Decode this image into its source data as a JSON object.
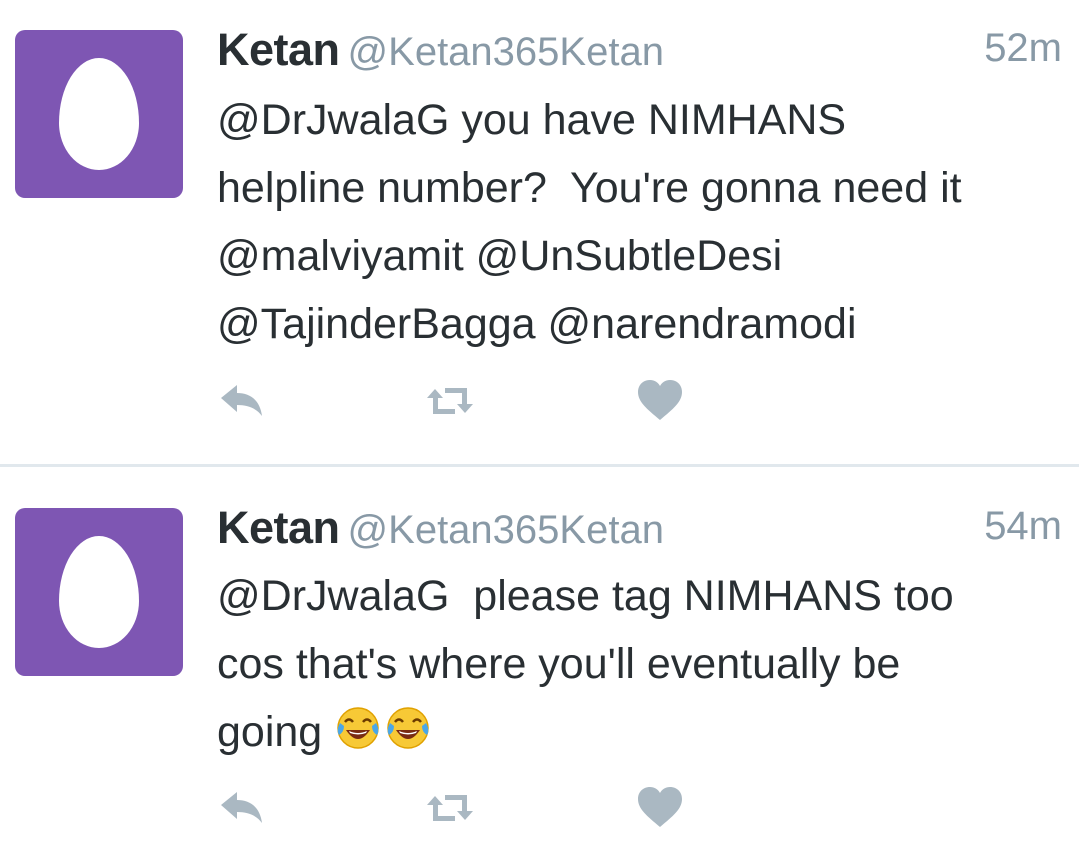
{
  "tweets": [
    {
      "name": "Ketan",
      "handle": "@Ketan365Ketan",
      "time": "52m",
      "lines": [
        "@DrJwalaG you have NIMHANS",
        "helpline number?  You're gonna need it",
        "@malviyamit @UnSubtleDesi",
        "@TajinderBagga @narendramodi"
      ]
    },
    {
      "name": "Ketan",
      "handle": "@Ketan365Ketan",
      "time": "54m",
      "lines": [
        "@DrJwalaG  please tag NIMHANS too",
        "cos that's where you'll eventually be",
        "going"
      ],
      "emojis": [
        "face-with-tears-of-joy",
        "face-with-tears-of-joy"
      ]
    }
  ],
  "colors": {
    "avatar": "#7e56b3",
    "text": "#292f33",
    "muted": "#8899a6",
    "icons": "#aab8c2",
    "divider": "#e1e8ed"
  },
  "icons": [
    "reply-icon",
    "retweet-icon",
    "like-icon"
  ]
}
